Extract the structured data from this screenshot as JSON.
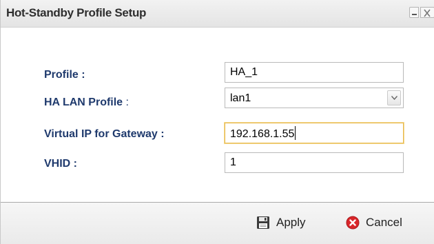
{
  "dialog": {
    "title": "Hot-Standby Profile Setup",
    "icons": {
      "minimize": "minimize-icon",
      "close": "close-icon"
    }
  },
  "form": {
    "profile": {
      "label": "Profile :",
      "value": "HA_1"
    },
    "ha_lan_profile": {
      "label": "HA LAN Profile",
      "colon": " :",
      "value": "lan1",
      "icon": "chevron-down-icon"
    },
    "virtual_ip": {
      "label": "Virtual IP for Gateway :",
      "value": "192.168.1.55"
    },
    "vhid": {
      "label": "VHID :",
      "value": "1"
    }
  },
  "footer": {
    "apply_label": "Apply",
    "apply_icon": "floppy-disk-icon",
    "cancel_label": "Cancel",
    "cancel_icon": "cancel-circle-icon"
  },
  "colors": {
    "label_text": "#1f3a6d",
    "focus_border": "#e8b84b",
    "cancel_red": "#d9262a"
  }
}
